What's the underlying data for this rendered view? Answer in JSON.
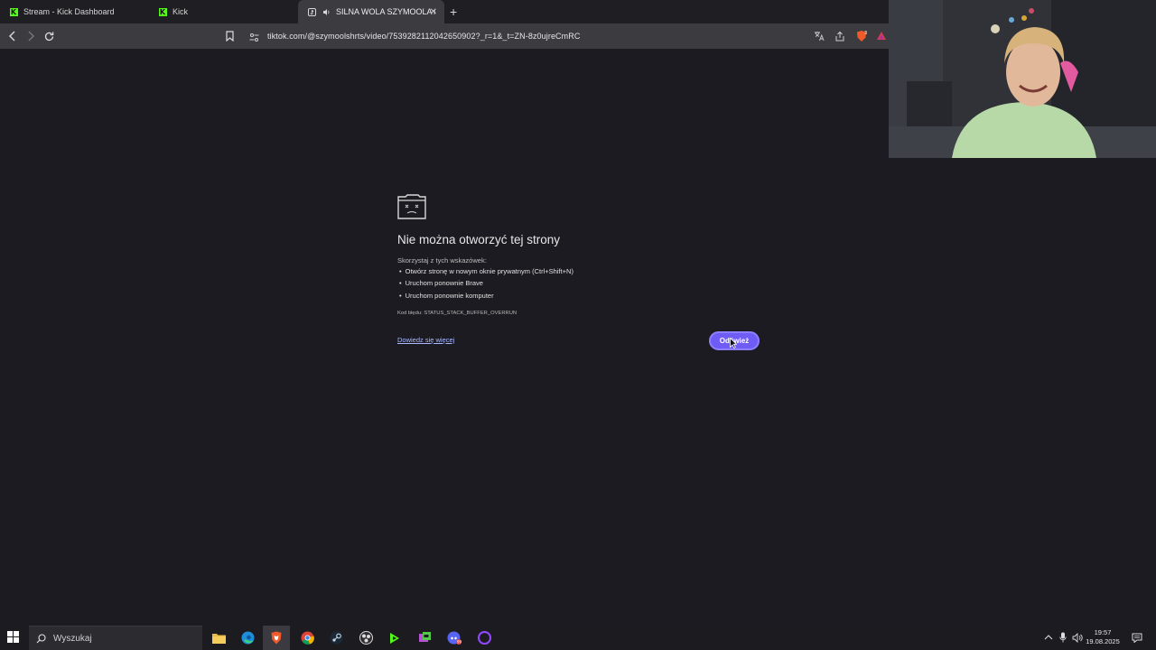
{
  "browser": {
    "tabs": [
      {
        "label": "Stream - Kick Dashboard",
        "icon": "kick-logo-icon"
      },
      {
        "label": "Kick",
        "icon": "kick-logo-icon"
      },
      {
        "label": "SILNA WOLA SZYMOOLA // ",
        "icon": "tiktok-icon",
        "active": true
      }
    ],
    "url": "tiktok.com/@szymoolshrts/video/7539282112042650902?_r=1&_t=ZN-8z0ujreCmRC"
  },
  "error_page": {
    "title": "Nie można otworzyć tej strony",
    "hints_intro": "Skorzystaj z tych wskazówek:",
    "hints": [
      "Otwórz stronę w nowym oknie prywatnym (Ctrl+Shift+N)",
      "Uruchom ponownie Brave",
      "Uruchom ponownie komputer"
    ],
    "error_code": "Kod błędu: STATUS_STACK_BUFFER_OVERRUN",
    "learn_more": "Dowiedz się więcej",
    "reload_button": "Odśwież"
  },
  "taskbar": {
    "search_placeholder": "Wyszukaj",
    "time": "19:57",
    "date": "19.08.2025"
  },
  "colors": {
    "background": "#1c1b22",
    "accent": "#6f5cf5",
    "kick_green": "#53fc18"
  }
}
